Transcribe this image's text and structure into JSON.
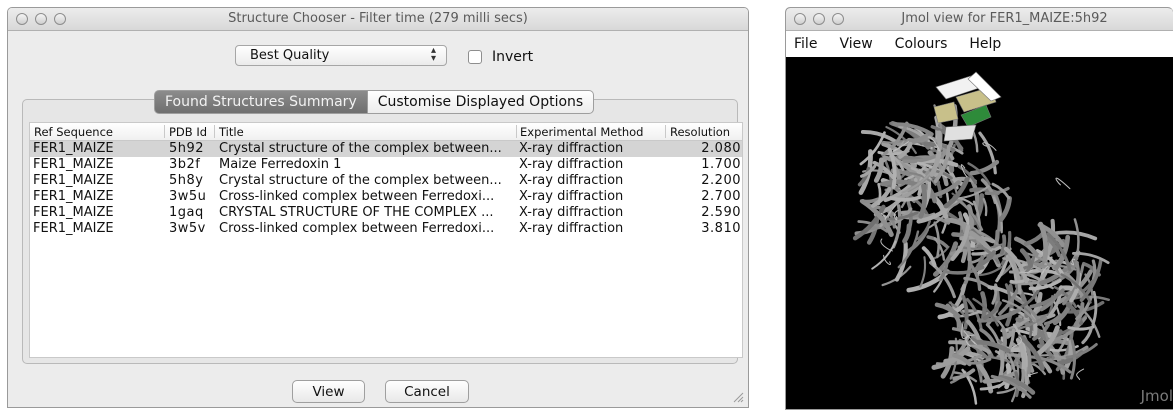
{
  "chooser": {
    "title": "Structure Chooser - Filter time (279 milli secs)",
    "filter_selected": "Best Quality",
    "invert_label": "Invert",
    "invert_checked": false,
    "tabs": [
      {
        "label": "Found Structures Summary",
        "selected": true
      },
      {
        "label": "Customise Displayed Options",
        "selected": false
      }
    ],
    "table": {
      "columns": [
        "Ref Sequence",
        "PDB Id",
        "Title",
        "Experimental Method",
        "Resolution"
      ],
      "rows": [
        {
          "ref": "FER1_MAIZE",
          "pdb": "5h92",
          "title": "Crystal structure of the complex between...",
          "method": "X-ray diffraction",
          "resolution": "2.080",
          "selected": true
        },
        {
          "ref": "FER1_MAIZE",
          "pdb": "3b2f",
          "title": "Maize Ferredoxin 1",
          "method": "X-ray diffraction",
          "resolution": "1.700",
          "selected": false
        },
        {
          "ref": "FER1_MAIZE",
          "pdb": "5h8y",
          "title": "Crystal structure of the complex between...",
          "method": "X-ray diffraction",
          "resolution": "2.200",
          "selected": false
        },
        {
          "ref": "FER1_MAIZE",
          "pdb": "3w5u",
          "title": "Cross-linked complex between Ferredoxi...",
          "method": "X-ray diffraction",
          "resolution": "2.700",
          "selected": false
        },
        {
          "ref": "FER1_MAIZE",
          "pdb": "1gaq",
          "title": "CRYSTAL STRUCTURE OF THE COMPLEX ...",
          "method": "X-ray diffraction",
          "resolution": "2.590",
          "selected": false
        },
        {
          "ref": "FER1_MAIZE",
          "pdb": "3w5v",
          "title": "Cross-linked complex between Ferredoxi...",
          "method": "X-ray diffraction",
          "resolution": "3.810",
          "selected": false
        }
      ]
    },
    "view_button": "View",
    "cancel_button": "Cancel"
  },
  "jmol": {
    "title": "Jmol view for FER1_MAIZE:5h92",
    "menu": [
      "File",
      "View",
      "Colours",
      "Help"
    ],
    "watermark": "Jmol",
    "colors": {
      "background": "#000000",
      "protein": "#8a8a8a",
      "ferredoxin_sheet": "#2e8b3a",
      "ferredoxin_helix": "#c8c08a"
    }
  },
  "icons": [
    "close-icon",
    "minimize-icon",
    "zoom-icon",
    "up-down-arrows-icon",
    "resize-grip-icon"
  ]
}
